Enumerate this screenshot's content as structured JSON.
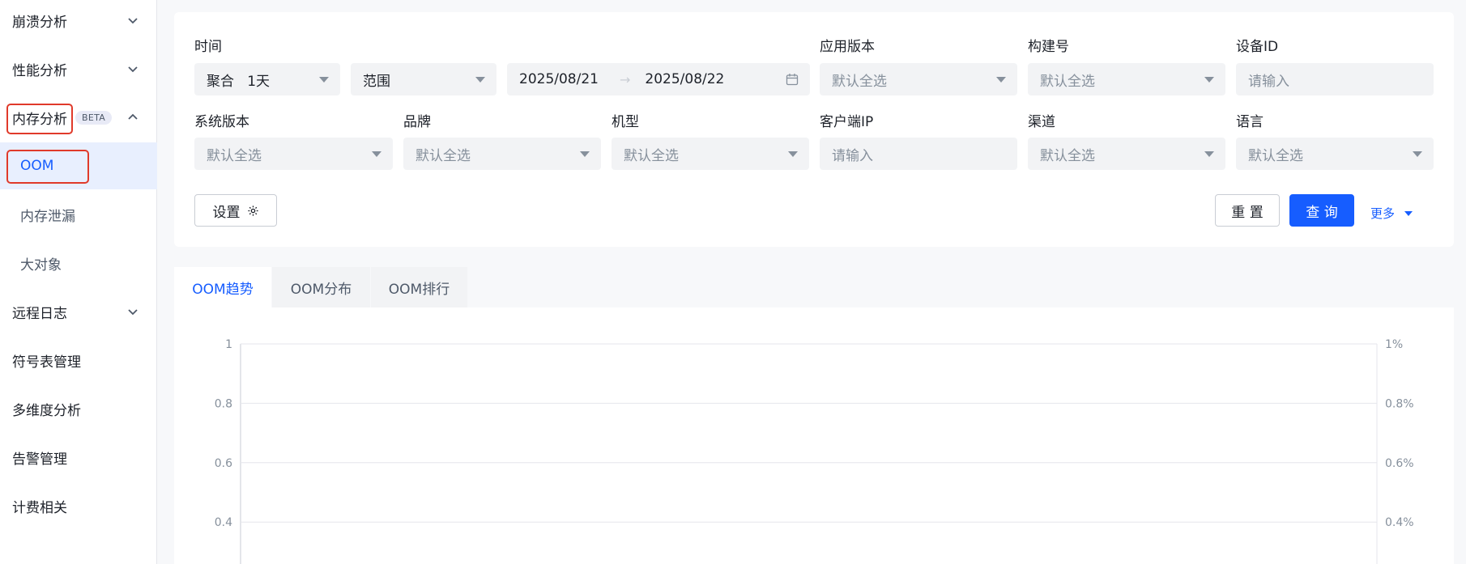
{
  "sidebar": {
    "items": [
      {
        "label": "崩溃分析",
        "expanded": false
      },
      {
        "label": "性能分析",
        "expanded": false
      },
      {
        "label": "内存分析",
        "badge": "BETA",
        "expanded": true
      },
      {
        "label": "远程日志",
        "expanded": false
      },
      {
        "label": "符号表管理"
      },
      {
        "label": "多维度分析"
      },
      {
        "label": "告警管理"
      },
      {
        "label": "计费相关"
      }
    ],
    "sub_items": [
      {
        "label": "OOM",
        "active": true
      },
      {
        "label": "内存泄漏"
      },
      {
        "label": "大对象"
      }
    ]
  },
  "filters": {
    "time_label": "时间",
    "aggregate_value": "聚合   1天",
    "range_value": "范围",
    "date_start": "2025/08/21",
    "date_arrow": "→",
    "date_end": "2025/08/22",
    "app_version_label": "应用版本",
    "app_version_placeholder": "默认全选",
    "build_label": "构建号",
    "build_placeholder": "默认全选",
    "device_id_label": "设备ID",
    "device_id_placeholder": "请输入",
    "os_version_label": "系统版本",
    "os_version_placeholder": "默认全选",
    "brand_label": "品牌",
    "brand_placeholder": "默认全选",
    "model_label": "机型",
    "model_placeholder": "默认全选",
    "client_ip_label": "客户端IP",
    "client_ip_placeholder": "请输入",
    "channel_label": "渠道",
    "channel_placeholder": "默认全选",
    "language_label": "语言",
    "language_placeholder": "默认全选"
  },
  "buttons": {
    "settings": "设置",
    "reset": "重 置",
    "query": "查 询",
    "more": "更多"
  },
  "tabs": [
    {
      "label": "OOM趋势",
      "active": true
    },
    {
      "label": "OOM分布"
    },
    {
      "label": "OOM排行"
    }
  ],
  "chart_data": {
    "type": "line",
    "series": [],
    "y_ticks_left": [
      "1",
      "0.8",
      "0.6",
      "0.4"
    ],
    "y_ticks_right": [
      "1%",
      "0.8%",
      "0.6%",
      "0.4%"
    ],
    "ylim_left": [
      0,
      1
    ],
    "ylim_right": [
      0,
      0.01
    ],
    "grid": true
  },
  "colors": {
    "accent": "#165dff",
    "highlight_box": "#e03a2a",
    "sidebar_active_bg": "#e8effe"
  }
}
